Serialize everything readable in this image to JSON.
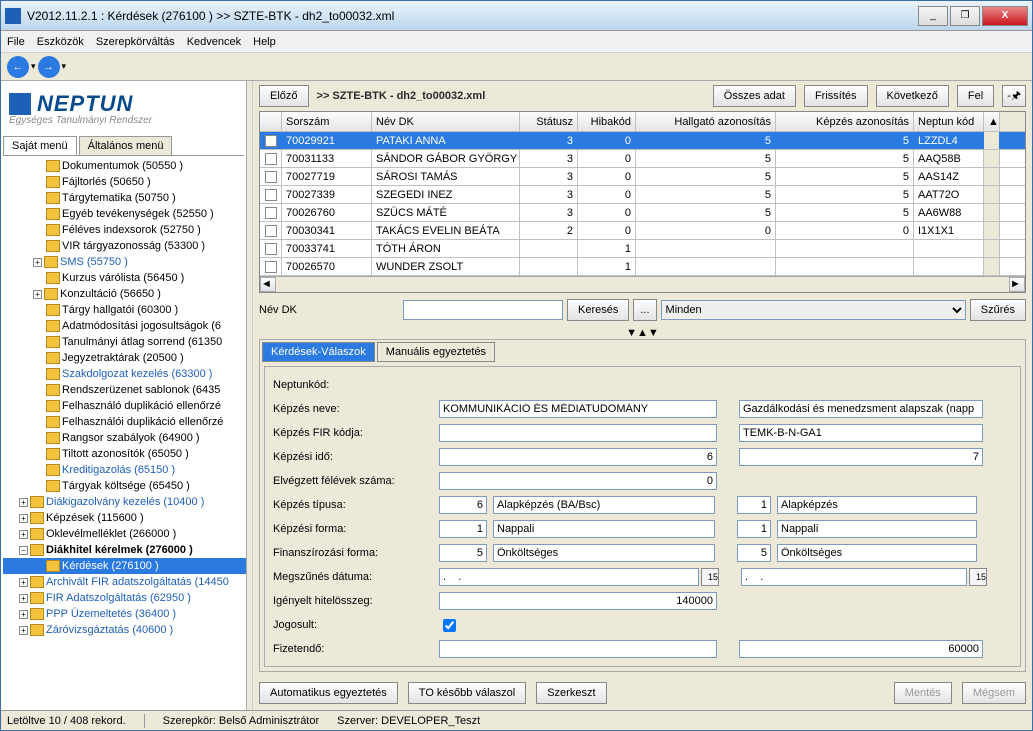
{
  "window_title": "V2012.11.2.1 : Kérdések (276100  )  >> SZTE-BTK - dh2_to00032.xml",
  "winbtns": {
    "min": "_",
    "max": "❐",
    "close": "X"
  },
  "menu": [
    "File",
    "Eszközök",
    "Szerepkörváltás",
    "Kedvencek",
    "Help"
  ],
  "logo": {
    "main": "NEPTUN",
    "sub": "Egységes Tanulmányi Rendszer"
  },
  "left_tabs": {
    "own": "Saját menü",
    "general": "Általános menü"
  },
  "tree": [
    {
      "indent": 2,
      "label": "Dokumentumok (50550  )"
    },
    {
      "indent": 2,
      "label": "Fájltorlés (50650  )"
    },
    {
      "indent": 2,
      "label": "Tárgytematika (50750  )"
    },
    {
      "indent": 2,
      "label": "Egyéb tevékenységek (52550  )"
    },
    {
      "indent": 2,
      "label": "Féléves indexsorok (52750  )"
    },
    {
      "indent": 2,
      "label": "VIR tárgyazonosság (53300  )"
    },
    {
      "indent": 2,
      "toggle": "+",
      "label": "SMS (55750  )",
      "blue": true
    },
    {
      "indent": 2,
      "label": "Kurzus várólista (56450  )"
    },
    {
      "indent": 2,
      "toggle": "+",
      "label": "Konzultáció (56650  )"
    },
    {
      "indent": 2,
      "label": "Tárgy hallgatói (60300  )"
    },
    {
      "indent": 2,
      "label": "Adatmódosítási jogosultságok (6"
    },
    {
      "indent": 2,
      "label": "Tanulmányi átlag sorrend (61350"
    },
    {
      "indent": 2,
      "label": "Jegyzetraktárak (20500  )"
    },
    {
      "indent": 2,
      "label": "Szakdolgozat kezelés (63300  )",
      "blue": true
    },
    {
      "indent": 2,
      "label": "Rendszerüzenet sablonok (6435"
    },
    {
      "indent": 2,
      "label": "Felhasználó duplikáció ellenőrzé"
    },
    {
      "indent": 2,
      "label": "Felhasználói duplikáció ellenőrzé"
    },
    {
      "indent": 2,
      "label": "Rangsor szabályok (64900  )"
    },
    {
      "indent": 2,
      "label": "Tiltott azonosítók (65050  )"
    },
    {
      "indent": 2,
      "label": "Kreditigazolás (65150  )",
      "blue": true
    },
    {
      "indent": 2,
      "label": "Tárgyak költsége (65450  )"
    },
    {
      "indent": 1,
      "toggle": "+",
      "label": "Diákigazolvány kezelés (10400  )",
      "blue": true
    },
    {
      "indent": 1,
      "toggle": "+",
      "label": "Képzések (115600  )"
    },
    {
      "indent": 1,
      "toggle": "+",
      "label": "Oklevélmelléklet (266000  )"
    },
    {
      "indent": 1,
      "toggle": "−",
      "label": "Diákhitel kérelmek (276000  )",
      "bold": true
    },
    {
      "indent": 2,
      "label": "Kérdések (276100  )",
      "blue": true,
      "selected": true
    },
    {
      "indent": 1,
      "toggle": "+",
      "label": "Archivált FIR adatszolgáltatás (14450",
      "blue": true
    },
    {
      "indent": 1,
      "toggle": "+",
      "label": "FIR Adatszolgáltatás (62950  )",
      "blue": true
    },
    {
      "indent": 1,
      "toggle": "+",
      "label": "PPP Üzemeltetés (36400  )",
      "blue": true
    },
    {
      "indent": 1,
      "toggle": "+",
      "label": "Záróvizsgáztatás (40600  )",
      "blue": true
    }
  ],
  "top": {
    "prev": "Előző",
    "breadcrumb": ">> SZTE-BTK - dh2_to00032.xml",
    "all": "Összes adat",
    "refresh": "Frissítés",
    "next": "Következő",
    "up": "Fel",
    "pin": "-🖈"
  },
  "grid": {
    "headers": {
      "n": "Sorszám",
      "name": "Név DK",
      "st": "Státusz",
      "err": "Hibakód",
      "hall": "Hallgató azonosítás",
      "kep": "Képzés azonosítás",
      "nk": "Neptun kód"
    },
    "rows": [
      {
        "n": "70029921",
        "name": "PATAKI ANNA",
        "st": "3",
        "err": "0",
        "hall": "5",
        "kep": "5",
        "nk": "LZZDL4",
        "sel": true
      },
      {
        "n": "70031133",
        "name": "SÁNDOR GÁBOR GYÖRGY",
        "st": "3",
        "err": "0",
        "hall": "5",
        "kep": "5",
        "nk": "AAQ58B"
      },
      {
        "n": "70027719",
        "name": "SÁROSI TAMÁS",
        "st": "3",
        "err": "0",
        "hall": "5",
        "kep": "5",
        "nk": "AAS14Z"
      },
      {
        "n": "70027339",
        "name": "SZEGEDI INEZ",
        "st": "3",
        "err": "0",
        "hall": "5",
        "kep": "5",
        "nk": "AAT72O"
      },
      {
        "n": "70026760",
        "name": "SZÜCS MÁTÉ",
        "st": "3",
        "err": "0",
        "hall": "5",
        "kep": "5",
        "nk": "AA6W88"
      },
      {
        "n": "70030341",
        "name": "TAKÁCS EVELIN BEÁTA",
        "st": "2",
        "err": "0",
        "hall": "0",
        "kep": "0",
        "nk": "I1X1X1"
      },
      {
        "n": "70033741",
        "name": "TÓTH ÁRON",
        "st": "",
        "err": "1",
        "hall": "",
        "kep": "",
        "nk": ""
      },
      {
        "n": "70026570",
        "name": "WUNDER ZSOLT",
        "st": "",
        "err": "1",
        "hall": "",
        "kep": "",
        "nk": ""
      }
    ]
  },
  "filter": {
    "label": "Név DK",
    "search": "Keresés",
    "dots": "...",
    "select": "Minden",
    "filterbtn": "Szűrés"
  },
  "panel": {
    "tab1": "Kérdések-Válaszok",
    "tab2": "Manuális egyeztetés"
  },
  "form": {
    "neptunkod": {
      "lbl": "Neptunkód:"
    },
    "kepzes_neve": {
      "lbl": "Képzés neve:",
      "v1": "KOMMUNIKÁCIÓ ÉS MÉDIATUDOMÁNY",
      "v2": "Gazdálkodási és menedzsment alapszak (napp"
    },
    "fir": {
      "lbl": "Képzés FIR kódja:",
      "v1": "",
      "v2": "TEMK-B-N-GA1"
    },
    "ido": {
      "lbl": "Képzési idő:",
      "v1": "6",
      "v2": "7"
    },
    "felev": {
      "lbl": "Elvégzett félévek száma:",
      "v1": "0"
    },
    "tipus": {
      "lbl": "Képzés típusa:",
      "c1": "6",
      "t1": "Alapképzés (BA/Bsc)",
      "c2": "1",
      "t2": "Alapképzés"
    },
    "forma": {
      "lbl": "Képzési forma:",
      "c1": "1",
      "t1": "Nappali",
      "c2": "1",
      "t2": "Nappali"
    },
    "fin": {
      "lbl": "Finanszírozási forma:",
      "c1": "5",
      "t1": "Önköltséges",
      "c2": "5",
      "t2": "Önköltséges"
    },
    "megszun": {
      "lbl": "Megszűnés dátuma:",
      "v1": ".    .",
      "v2": ".    ."
    },
    "hitel": {
      "lbl": "Igényelt hitelösszeg:",
      "v1": "140000"
    },
    "jog": {
      "lbl": "Jogosult:"
    },
    "fiz": {
      "lbl": "Fizetendő:",
      "v2": "60000"
    }
  },
  "actions": {
    "auto": "Automatikus egyeztetés",
    "later": "TO később válaszol",
    "edit": "Szerkeszt",
    "save": "Mentés",
    "cancel": "Mégsem"
  },
  "status": {
    "left": "Letöltve 10 / 408 rekord.",
    "role": "Szerepkör: Belső Adminisztrátor",
    "server": "Szerver: DEVELOPER_Teszt"
  }
}
